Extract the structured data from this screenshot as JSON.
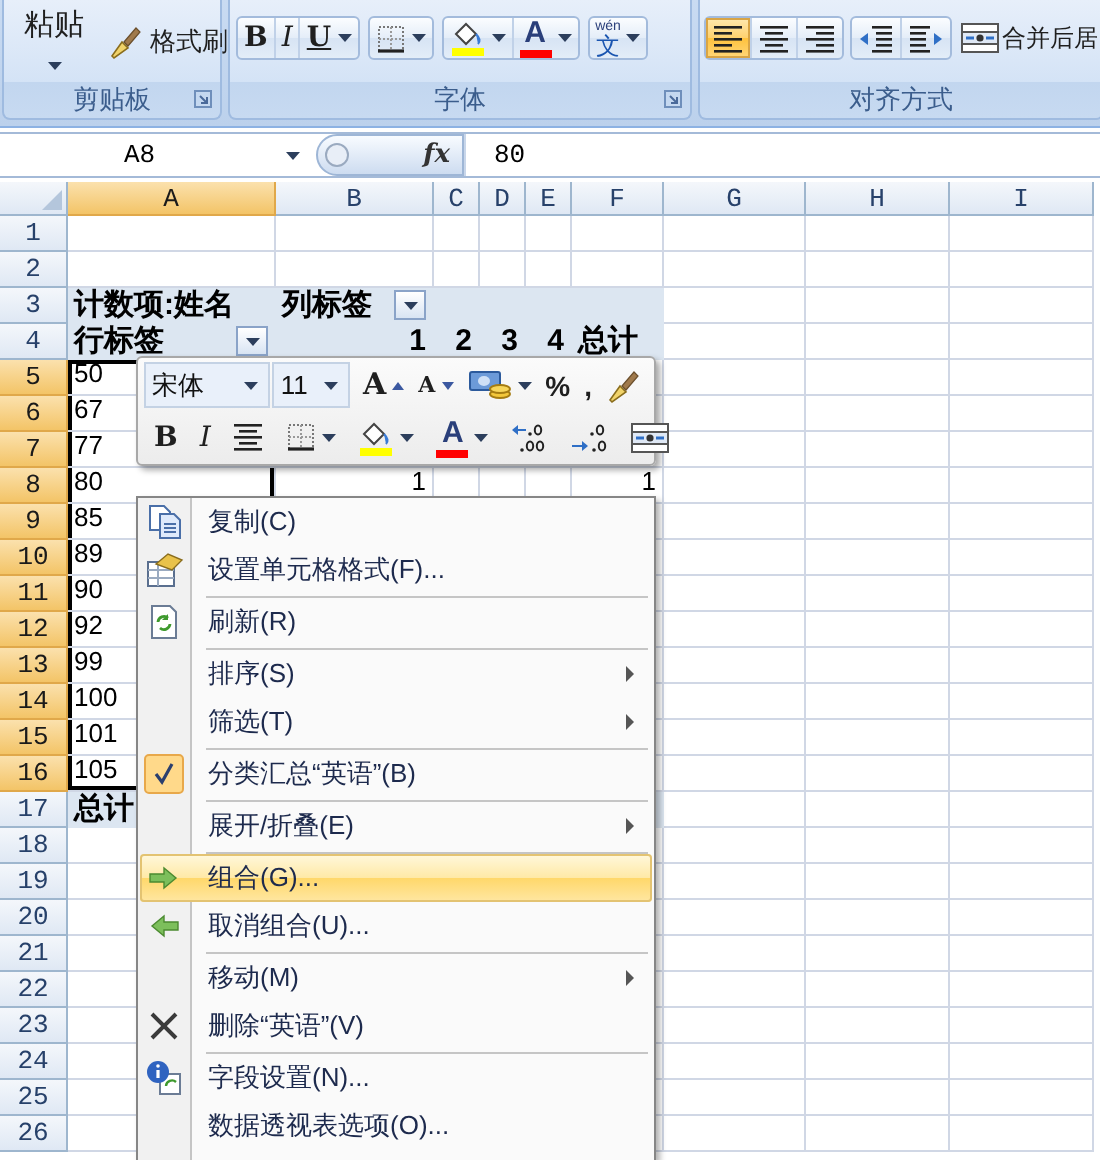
{
  "ribbon": {
    "groups": [
      {
        "label": "剪贴板",
        "kind": "large",
        "launcher": true,
        "clusters": [
          {
            "buttons": [
              {
                "kind": "paste",
                "label": "粘贴",
                "dropdown": true
              }
            ]
          },
          {
            "buttons": [
              {
                "kind": "format-painter",
                "label": "格式刷"
              }
            ]
          }
        ]
      },
      {
        "label": "字体",
        "kind": "compact",
        "launcher": true,
        "clusters": [
          {
            "framed": true,
            "buttons": [
              {
                "kind": "bold",
                "label": "B"
              },
              {
                "kind": "italic",
                "label": "I"
              },
              {
                "kind": "underline",
                "label": "U",
                "dropdown": true
              }
            ]
          },
          {
            "framed": true,
            "buttons": [
              {
                "kind": "border",
                "dropdown": true
              }
            ]
          },
          {
            "framed": true,
            "buttons": [
              {
                "kind": "fill",
                "dropdown": true
              },
              {
                "kind": "font-color",
                "label": "A",
                "dropdown": true
              }
            ]
          },
          {
            "framed": true,
            "buttons": [
              {
                "kind": "phonetic",
                "label": "文",
                "ruby": "wén",
                "dropdown": true
              }
            ]
          }
        ]
      },
      {
        "label": "对齐方式",
        "kind": "compact",
        "clusters": [
          {
            "framed": true,
            "buttons": [
              {
                "kind": "align-left",
                "selected": true
              },
              {
                "kind": "align-center",
                "selected": false
              },
              {
                "kind": "align-right",
                "selected": false
              }
            ]
          },
          {
            "framed": true,
            "buttons": [
              {
                "kind": "decrease-indent"
              },
              {
                "kind": "increase-indent"
              }
            ]
          },
          {
            "buttons": [
              {
                "kind": "merge",
                "label": "合并后居"
              }
            ]
          }
        ]
      }
    ]
  },
  "formula_bar": {
    "name_box": "A8",
    "function_button": "fx",
    "value": "80"
  },
  "sheet": {
    "columns": [
      {
        "label": "A",
        "selected": true
      },
      {
        "label": "B",
        "selected": false
      },
      {
        "label": "C",
        "selected": false
      },
      {
        "label": "D",
        "selected": false
      },
      {
        "label": "E",
        "selected": false
      },
      {
        "label": "F",
        "selected": false
      },
      {
        "label": "G",
        "selected": false
      },
      {
        "label": "H",
        "selected": false
      },
      {
        "label": "I",
        "selected": false
      }
    ],
    "rows": [
      {
        "label": "1",
        "kind": "plain",
        "selected": false
      },
      {
        "label": "2",
        "kind": "plain",
        "selected": false
      },
      {
        "label": "3",
        "kind": "pivot-header",
        "selected": false,
        "cells": {
          "a": {
            "text": "计数项:姓名"
          },
          "b": {
            "text": "列标签",
            "filter": true
          }
        }
      },
      {
        "label": "4",
        "kind": "pivot-header",
        "selected": false,
        "cells": {
          "a": {
            "text": "行标签",
            "filter": true
          },
          "b": {
            "text": "1"
          },
          "c": {
            "text": "2"
          },
          "d": {
            "text": "3"
          },
          "e": {
            "text": "4"
          },
          "f": {
            "text": "总计"
          }
        }
      },
      {
        "label": "5",
        "kind": "pivot-row",
        "selected": true,
        "cells": {
          "a": {
            "text": "50"
          }
        }
      },
      {
        "label": "6",
        "kind": "pivot-row",
        "selected": true,
        "cells": {
          "a": {
            "text": "67"
          }
        }
      },
      {
        "label": "7",
        "kind": "pivot-row",
        "selected": true,
        "cells": {
          "a": {
            "text": "77"
          }
        }
      },
      {
        "label": "8",
        "kind": "pivot-row",
        "selected": true,
        "cells": {
          "a": {
            "text": "80"
          },
          "b": {
            "text": "1"
          },
          "f": {
            "text": "1"
          }
        }
      },
      {
        "label": "9",
        "kind": "pivot-row",
        "selected": true,
        "cells": {
          "a": {
            "text": "85"
          }
        }
      },
      {
        "label": "10",
        "kind": "pivot-row",
        "selected": true,
        "cells": {
          "a": {
            "text": "89"
          }
        }
      },
      {
        "label": "11",
        "kind": "pivot-row",
        "selected": true,
        "cells": {
          "a": {
            "text": "90"
          }
        }
      },
      {
        "label": "12",
        "kind": "pivot-row",
        "selected": true,
        "cells": {
          "a": {
            "text": "92"
          }
        }
      },
      {
        "label": "13",
        "kind": "pivot-row",
        "selected": true,
        "cells": {
          "a": {
            "text": "99"
          }
        }
      },
      {
        "label": "14",
        "kind": "pivot-row",
        "selected": true,
        "cells": {
          "a": {
            "text": "100"
          }
        }
      },
      {
        "label": "15",
        "kind": "pivot-row",
        "selected": true,
        "cells": {
          "a": {
            "text": "101"
          }
        }
      },
      {
        "label": "16",
        "kind": "pivot-row",
        "selected": true,
        "cells": {
          "a": {
            "text": "105"
          }
        }
      },
      {
        "label": "17",
        "kind": "pivot-total",
        "selected": false,
        "cells": {
          "a": {
            "text": "总计"
          }
        }
      },
      {
        "label": "18",
        "kind": "plain",
        "selected": false
      },
      {
        "label": "19",
        "kind": "plain",
        "selected": false
      },
      {
        "label": "20",
        "kind": "plain",
        "selected": false
      },
      {
        "label": "21",
        "kind": "plain",
        "selected": false
      },
      {
        "label": "22",
        "kind": "plain",
        "selected": false
      },
      {
        "label": "23",
        "kind": "plain",
        "selected": false
      },
      {
        "label": "24",
        "kind": "plain",
        "selected": false
      },
      {
        "label": "25",
        "kind": "plain",
        "selected": false
      },
      {
        "label": "26",
        "kind": "plain",
        "selected": false
      }
    ]
  },
  "mini_toolbar": {
    "font_field": {
      "value": "宋体"
    },
    "size_field": {
      "value": "11"
    },
    "rows": [
      [
        {
          "kind": "grow-font",
          "label": "A"
        },
        {
          "kind": "shrink-font",
          "label": "A"
        },
        {
          "kind": "accounting",
          "dropdown": true
        },
        {
          "kind": "percent",
          "label": "%"
        },
        {
          "kind": "comma",
          "label": ","
        },
        {
          "kind": "format-painter"
        }
      ],
      [
        {
          "kind": "bold",
          "label": "B"
        },
        {
          "kind": "italic",
          "label": "I"
        },
        {
          "kind": "center"
        },
        {
          "kind": "border",
          "dropdown": true
        },
        {
          "kind": "fill",
          "dropdown": true
        },
        {
          "kind": "font-color",
          "label": "A",
          "dropdown": true
        },
        {
          "kind": "increase-decimal"
        },
        {
          "kind": "decrease-decimal"
        },
        {
          "kind": "merge-center"
        }
      ]
    ]
  },
  "context_menu": {
    "items": [
      {
        "kind": "item",
        "label": "复制(C)",
        "selected": false,
        "checked": false,
        "submenu": false
      },
      {
        "kind": "item",
        "label": "设置单元格格式(F)...",
        "selected": false,
        "checked": false,
        "submenu": false
      },
      {
        "kind": "separator"
      },
      {
        "kind": "item",
        "label": "刷新(R)",
        "selected": false,
        "checked": false,
        "submenu": false
      },
      {
        "kind": "separator"
      },
      {
        "kind": "item",
        "label": "排序(S)",
        "selected": false,
        "checked": false,
        "submenu": true
      },
      {
        "kind": "item",
        "label": "筛选(T)",
        "selected": false,
        "checked": false,
        "submenu": true
      },
      {
        "kind": "separator"
      },
      {
        "kind": "item",
        "label": "分类汇总“英语”(B)",
        "selected": false,
        "checked": true,
        "submenu": false
      },
      {
        "kind": "separator"
      },
      {
        "kind": "item",
        "label": "展开/折叠(E)",
        "selected": false,
        "checked": false,
        "submenu": true
      },
      {
        "kind": "separator"
      },
      {
        "kind": "item",
        "label": "组合(G)...",
        "selected": true,
        "checked": false,
        "submenu": false
      },
      {
        "kind": "item",
        "label": "取消组合(U)...",
        "selected": false,
        "checked": false,
        "submenu": false
      },
      {
        "kind": "separator"
      },
      {
        "kind": "item",
        "label": "移动(M)",
        "selected": false,
        "checked": false,
        "submenu": true
      },
      {
        "kind": "item",
        "label": "删除“英语”(V)",
        "selected": false,
        "checked": false,
        "submenu": false
      },
      {
        "kind": "separator"
      },
      {
        "kind": "item",
        "label": "字段设置(N)...",
        "selected": false,
        "checked": false,
        "submenu": false
      },
      {
        "kind": "item",
        "label": "数据透视表选项(O)...",
        "selected": false,
        "checked": false,
        "submenu": false
      }
    ]
  }
}
